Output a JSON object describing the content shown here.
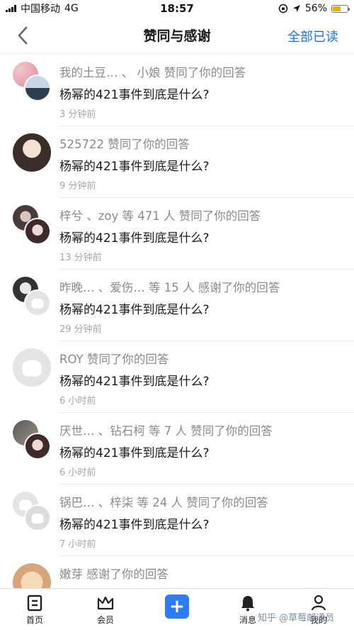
{
  "status_bar": {
    "carrier": "中国移动",
    "network": "4G",
    "time": "18:57",
    "battery": "56%",
    "battery_level": 0.56
  },
  "nav": {
    "title": "赞同与感谢",
    "mark_all_read": "全部已读"
  },
  "notifications": [
    {
      "actors": "我的土豆… 、 小娘 赞同了你的回答",
      "question": "杨幂的421事件到底是什么?",
      "time": "3 分钟前"
    },
    {
      "actors": "525722 赞同了你的回答",
      "question": "杨幂的421事件到底是什么?",
      "time": "9 分钟前"
    },
    {
      "actors": "梓兮 、zoy 等 471 人 赞同了你的回答",
      "question": "杨幂的421事件到底是什么?",
      "time": "13 分钟前"
    },
    {
      "actors": "昨晚… 、爱伤… 等 15 人 感谢了你的回答",
      "question": "杨幂的421事件到底是什么?",
      "time": "29 分钟前"
    },
    {
      "actors": "ROY 赞同了你的回答",
      "question": "杨幂的421事件到底是什么?",
      "time": "6 小时前"
    },
    {
      "actors": "厌世… 、钻石柯 等 7 人 赞同了你的回答",
      "question": "杨幂的421事件到底是什么?",
      "time": "6 小时前"
    },
    {
      "actors": "锅巴… 、梓柒 等 24 人 赞同了你的回答",
      "question": "杨幂的421事件到底是什么?",
      "time": "7 小时前"
    },
    {
      "actors": "嫩芽 感谢了你的回答",
      "question": "",
      "time": ""
    }
  ],
  "tab_bar": {
    "home": "首页",
    "member": "会员",
    "plus": "+",
    "messages": "消息",
    "mine": "我的",
    "watermark": "知乎 @草莓邮递员"
  },
  "colors": {
    "accent": "#1a73e8",
    "plus_button": "#2d7cf6"
  }
}
